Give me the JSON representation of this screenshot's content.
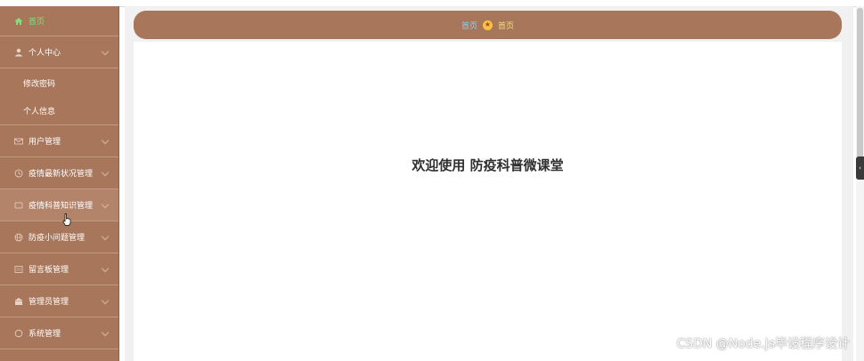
{
  "sidebar": {
    "home_label": "首页",
    "items": [
      {
        "label": "个人中心",
        "icon": "user-icon"
      },
      {
        "label": "用户管理",
        "icon": "mail-icon"
      },
      {
        "label": "疫情最新状况管理",
        "icon": "clock-icon"
      },
      {
        "label": "疫情科普知识管理",
        "icon": "box-icon"
      },
      {
        "label": "防疫小问题管理",
        "icon": "globe-icon"
      },
      {
        "label": "留言板管理",
        "icon": "list-icon"
      },
      {
        "label": "管理员管理",
        "icon": "bank-icon"
      },
      {
        "label": "系统管理",
        "icon": "circle-icon"
      }
    ],
    "subitems": [
      "修改密码",
      "个人信息"
    ]
  },
  "breadcrumb": {
    "home": "首页",
    "current": "首页"
  },
  "main": {
    "welcome": "欢迎使用 防疫科普微课堂"
  },
  "watermark": "CSDN @Node.js毕设程序设计",
  "colors": {
    "sidebar_bg": "#a8765a",
    "home_active": "#7ee07e",
    "breadcrumb_link": "#8fd0ef",
    "breadcrumb_current": "#f2e07a"
  },
  "side_tab": "‹"
}
